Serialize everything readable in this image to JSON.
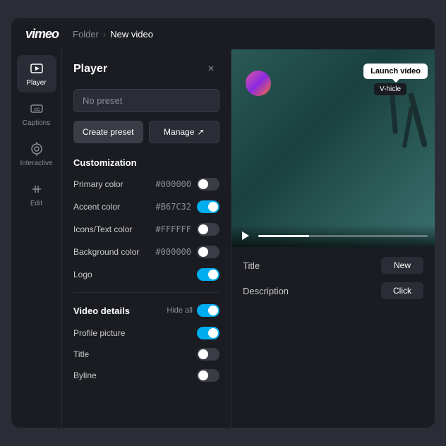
{
  "app": {
    "logo": "vimeo",
    "breadcrumb": {
      "folder": "Folder",
      "separator": "›",
      "current": "New video"
    }
  },
  "sidebar": {
    "items": [
      {
        "id": "player",
        "label": "Player",
        "active": true
      },
      {
        "id": "captions",
        "label": "Captions",
        "active": false
      },
      {
        "id": "interactive",
        "label": "Interactive",
        "active": false
      },
      {
        "id": "edit",
        "label": "Edit",
        "active": false
      }
    ]
  },
  "panel": {
    "title": "Player",
    "close_label": "×",
    "preset_placeholder": "No preset",
    "create_preset_label": "Create preset",
    "manage_label": "Manage",
    "manage_icon": "↗",
    "customization": {
      "heading": "Customization",
      "colors": [
        {
          "label": "Primary color",
          "hex": "#000000",
          "state": "off"
        },
        {
          "label": "Accent color",
          "hex": "#B67C32",
          "state": "on"
        },
        {
          "label": "Icons/Text color",
          "hex": "#FFFFFF",
          "state": "off"
        },
        {
          "label": "Background color",
          "hex": "#000000",
          "state": "off"
        },
        {
          "label": "Logo",
          "hex": "",
          "state": "on"
        }
      ]
    },
    "video_details": {
      "heading": "Video details",
      "hide_all_label": "Hide all",
      "hide_all_state": "on",
      "items": [
        {
          "label": "Profile picture",
          "state": "on"
        },
        {
          "label": "Title",
          "state": "off"
        },
        {
          "label": "Byline",
          "state": "off"
        }
      ]
    }
  },
  "video_preview": {
    "launch_tooltip": "Launch video",
    "vhicle_badge": "V-hicle"
  },
  "info": {
    "title_label": "Title",
    "title_value": "New",
    "description_label": "Description",
    "description_value": "Click"
  }
}
